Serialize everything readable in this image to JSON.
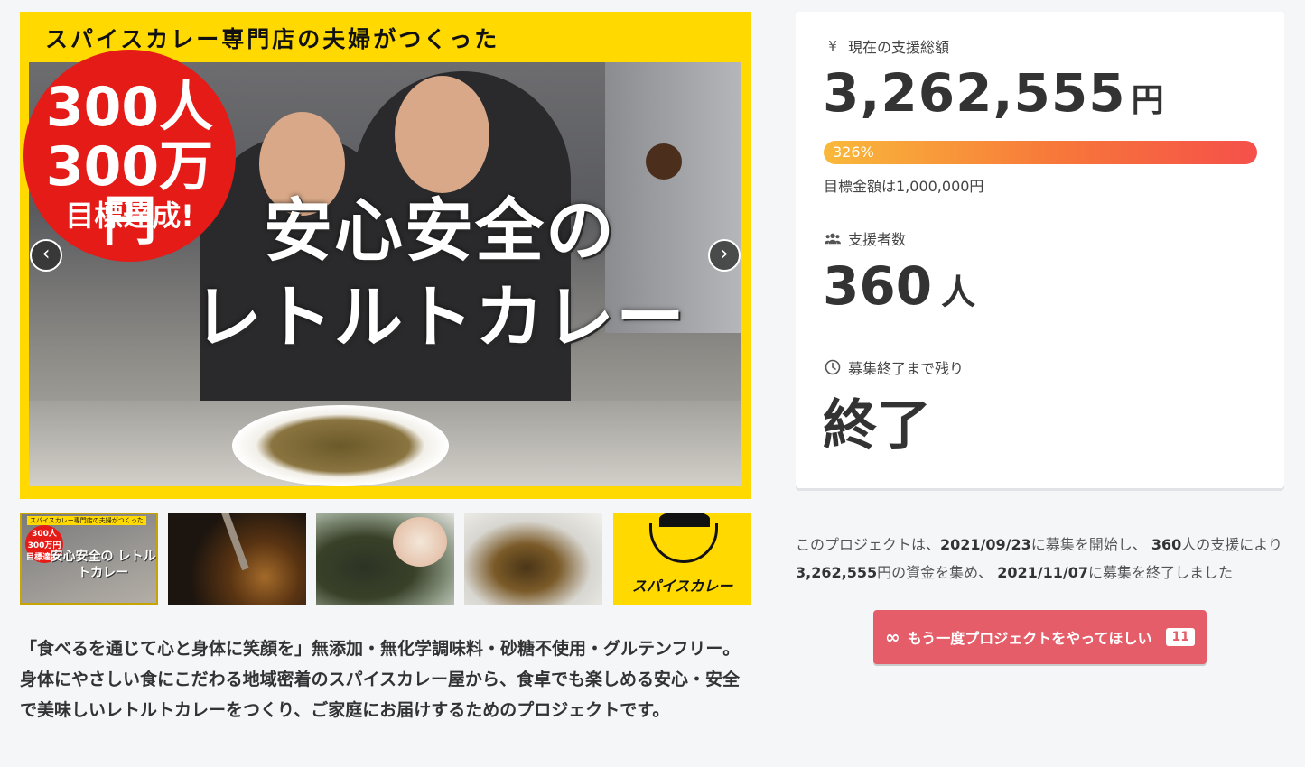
{
  "hero": {
    "banner": "スパイスカレー専門店の夫婦がつくった",
    "badge_line1": "300人",
    "badge_line2": "300万円",
    "badge_line3": "目標達成!",
    "title_line1": "安心安全の",
    "title_line2": "レトルトカレー",
    "prev_icon": "‹",
    "next_icon": "›"
  },
  "thumbnails": {
    "t1_banner": "スパイスカレー専門店の夫婦がつくった",
    "t1_badge": "300人 300万円 目標達成!",
    "t1_title": "安心安全の レトルトカレー",
    "t5_logo_text": "スパイスカレー"
  },
  "description": "「食べるを通じて心と身体に笑顔を」無添加・無化学調味料・砂糖不使用・グルテンフリー。身体にやさしい食にこだわる地域密着のスパイスカレー屋から、食卓でも楽しめる安心・安全で美味しいレトルトカレーをつくり、ご家庭にお届けするためのプロジェクトです。",
  "stats": {
    "total_label": "現在の支援総額",
    "total_icon": "¥",
    "total_amount": "3,262,555",
    "total_unit": "円",
    "progress_percent": 326,
    "progress_label": "326%",
    "goal_text": "目標金額は1,000,000円",
    "backers_label": "支援者数",
    "backers_count": "360",
    "backers_unit": "人",
    "remaining_label": "募集終了まで残り",
    "remaining_value": "終了"
  },
  "summary": {
    "p1": "このプロジェクトは、",
    "start_date": "2021/09/23",
    "p2": "に募集を開始し、",
    "backers": "360",
    "p3": "人の支援により",
    "amount": "3,262,555",
    "p4": "円の資金を集め、",
    "end_date": "2021/11/07",
    "p5": "に募集を終了しました"
  },
  "request_button": {
    "icon": "∞",
    "label": "もう一度プロジェクトをやってほしい",
    "count": "11"
  },
  "colors": {
    "accent_yellow": "#ffd900",
    "badge_red": "#e41b17",
    "button_red": "#e45d69",
    "progress_start": "#f9b93a",
    "progress_end": "#f5504a"
  }
}
